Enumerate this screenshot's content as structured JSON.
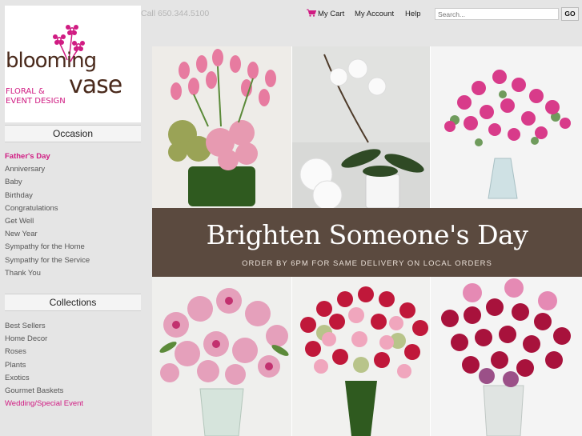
{
  "logo": {
    "brand_line1": "blooming",
    "brand_line2": "vase",
    "tagline1": "FLORAL &",
    "tagline2": "EVENT DESIGN"
  },
  "header": {
    "phone": "Call 650.344.5100",
    "cart_label": "My Cart",
    "account_label": "My Account",
    "help_label": "Help",
    "search_placeholder": "Search...",
    "go_label": "GO"
  },
  "sidebar": {
    "occasion_title": "Occasion",
    "occasion_items": [
      {
        "label": "Father's Day"
      },
      {
        "label": "Anniversary"
      },
      {
        "label": "Baby"
      },
      {
        "label": "Birthday"
      },
      {
        "label": "Congratulations"
      },
      {
        "label": "Get Well"
      },
      {
        "label": "New Year"
      },
      {
        "label": "Sympathy for the Home"
      },
      {
        "label": "Sympathy for the Service"
      },
      {
        "label": "Thank You"
      }
    ],
    "collections_title": "Collections",
    "collection_items": [
      {
        "label": "Best Sellers"
      },
      {
        "label": "Home Decor"
      },
      {
        "label": "Roses"
      },
      {
        "label": "Plants"
      },
      {
        "label": "Exotics"
      },
      {
        "label": "Gourmet Baskets"
      },
      {
        "label": "Wedding/Special Event"
      }
    ]
  },
  "hero": {
    "headline": "Brighten Someone's Day",
    "subline": "ORDER BY 6PM FOR SAME DELIVERY ON LOCAL ORDERS"
  },
  "colors": {
    "accent": "#d01b82",
    "brand_brown": "#4a2a1c",
    "banner_bg": "#5b4a3f"
  }
}
